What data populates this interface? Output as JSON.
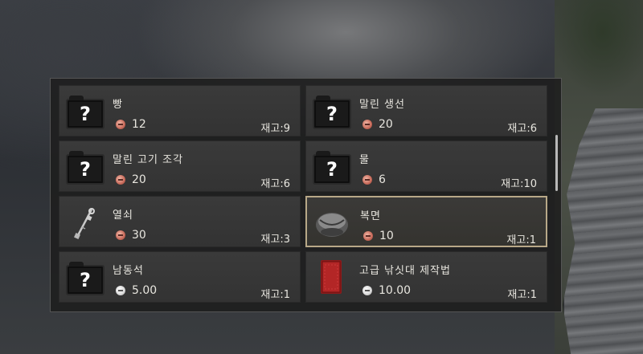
{
  "shop": {
    "items": [
      {
        "name": "빵",
        "price": "12",
        "stock": "재고:9",
        "icon": "unknown-item-icon",
        "coin": "copper"
      },
      {
        "name": "말린 생선",
        "price": "20",
        "stock": "재고:6",
        "icon": "unknown-item-icon",
        "coin": "copper"
      },
      {
        "name": "말린 고기 조각",
        "price": "20",
        "stock": "재고:6",
        "icon": "unknown-item-icon",
        "coin": "copper"
      },
      {
        "name": "물",
        "price": "6",
        "stock": "재고:10",
        "icon": "unknown-item-icon",
        "coin": "copper"
      },
      {
        "name": "열쇠",
        "price": "30",
        "stock": "재고:3",
        "icon": "key-icon",
        "coin": "copper"
      },
      {
        "name": "복면",
        "price": "10",
        "stock": "재고:1",
        "icon": "mask-icon",
        "coin": "copper",
        "selected": true
      },
      {
        "name": "남동석",
        "price": "5.00",
        "stock": "재고:1",
        "icon": "unknown-item-icon",
        "coin": "silver"
      },
      {
        "name": "고급 낚싯대 제작법",
        "price": "10.00",
        "stock": "재고:1",
        "icon": "recipe-book-icon",
        "coin": "silver"
      }
    ],
    "question_mark": "?",
    "colors": {
      "selected_border": "#b8a888",
      "copper_coin": "#c86a5a",
      "silver_coin": "#d8d8d8",
      "text": "#e8e6df"
    }
  }
}
